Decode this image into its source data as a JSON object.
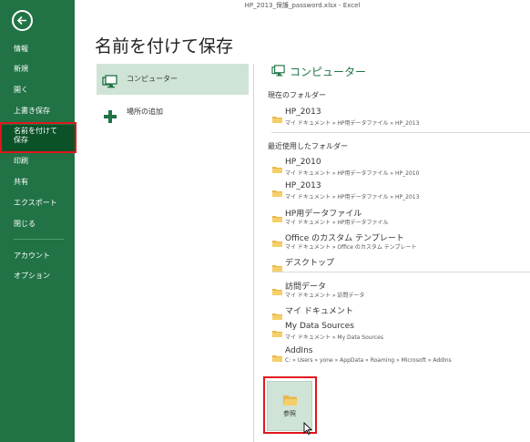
{
  "window": {
    "title": "HP_2013_保護_password.xlsx - Excel"
  },
  "page": {
    "title": "名前を付けて保存"
  },
  "backstage": {
    "items": [
      {
        "label": "情報"
      },
      {
        "label": "新規"
      },
      {
        "label": "開く"
      },
      {
        "label": "上書き保存"
      },
      {
        "label": "名前を付けて保存",
        "line1": "名前を付けて",
        "line2": "保存",
        "selected": true
      },
      {
        "label": "印刷"
      },
      {
        "label": "共有"
      },
      {
        "label": "エクスポート"
      },
      {
        "label": "閉じる"
      },
      {
        "label": "アカウント"
      },
      {
        "label": "オプション"
      }
    ]
  },
  "places": [
    {
      "label": "コンピューター",
      "icon": "computer-icon",
      "selected": true
    },
    {
      "label": "場所の追加",
      "icon": "plus-icon",
      "selected": false
    }
  ],
  "panel": {
    "header": "コンピューター",
    "current_label": "現在のフォルダー",
    "current": [
      {
        "name": "HP_2013",
        "path": "マイ ドキュメント » HP用データファイル » HP_2013"
      }
    ],
    "recent_label": "最近使用したフォルダー",
    "recent": [
      {
        "name": "HP_2010",
        "path": "マイ ドキュメント » HP用データファイル » HP_2010"
      },
      {
        "name": "HP_2013",
        "path": "マイ ドキュメント » HP用データファイル » HP_2013"
      },
      {
        "name": "HP用データファイル",
        "path": "マイ ドキュメント » HP用データファイル"
      },
      {
        "name": "Office のカスタム テンプレート",
        "path": "マイ ドキュメント » Office のカスタム テンプレート"
      },
      {
        "name": "デスクトップ",
        "path": ""
      }
    ],
    "other": [
      {
        "name": "訪問データ",
        "path": "マイ ドキュメント » 訪問データ"
      },
      {
        "name": "マイ ドキュメント",
        "path": ""
      },
      {
        "name": "My Data Sources",
        "path": "マイ ドキュメント » My Data Sources"
      },
      {
        "name": "AddIns",
        "path": "C: » Users » yone » AppData » Roaming » Microsoft » AddIns"
      }
    ],
    "browse_label": "参照"
  },
  "colors": {
    "accent": "#217346",
    "selected_bg": "#cfe4d6",
    "highlight": "#e0161d",
    "nav_selected": "#0b5229"
  }
}
